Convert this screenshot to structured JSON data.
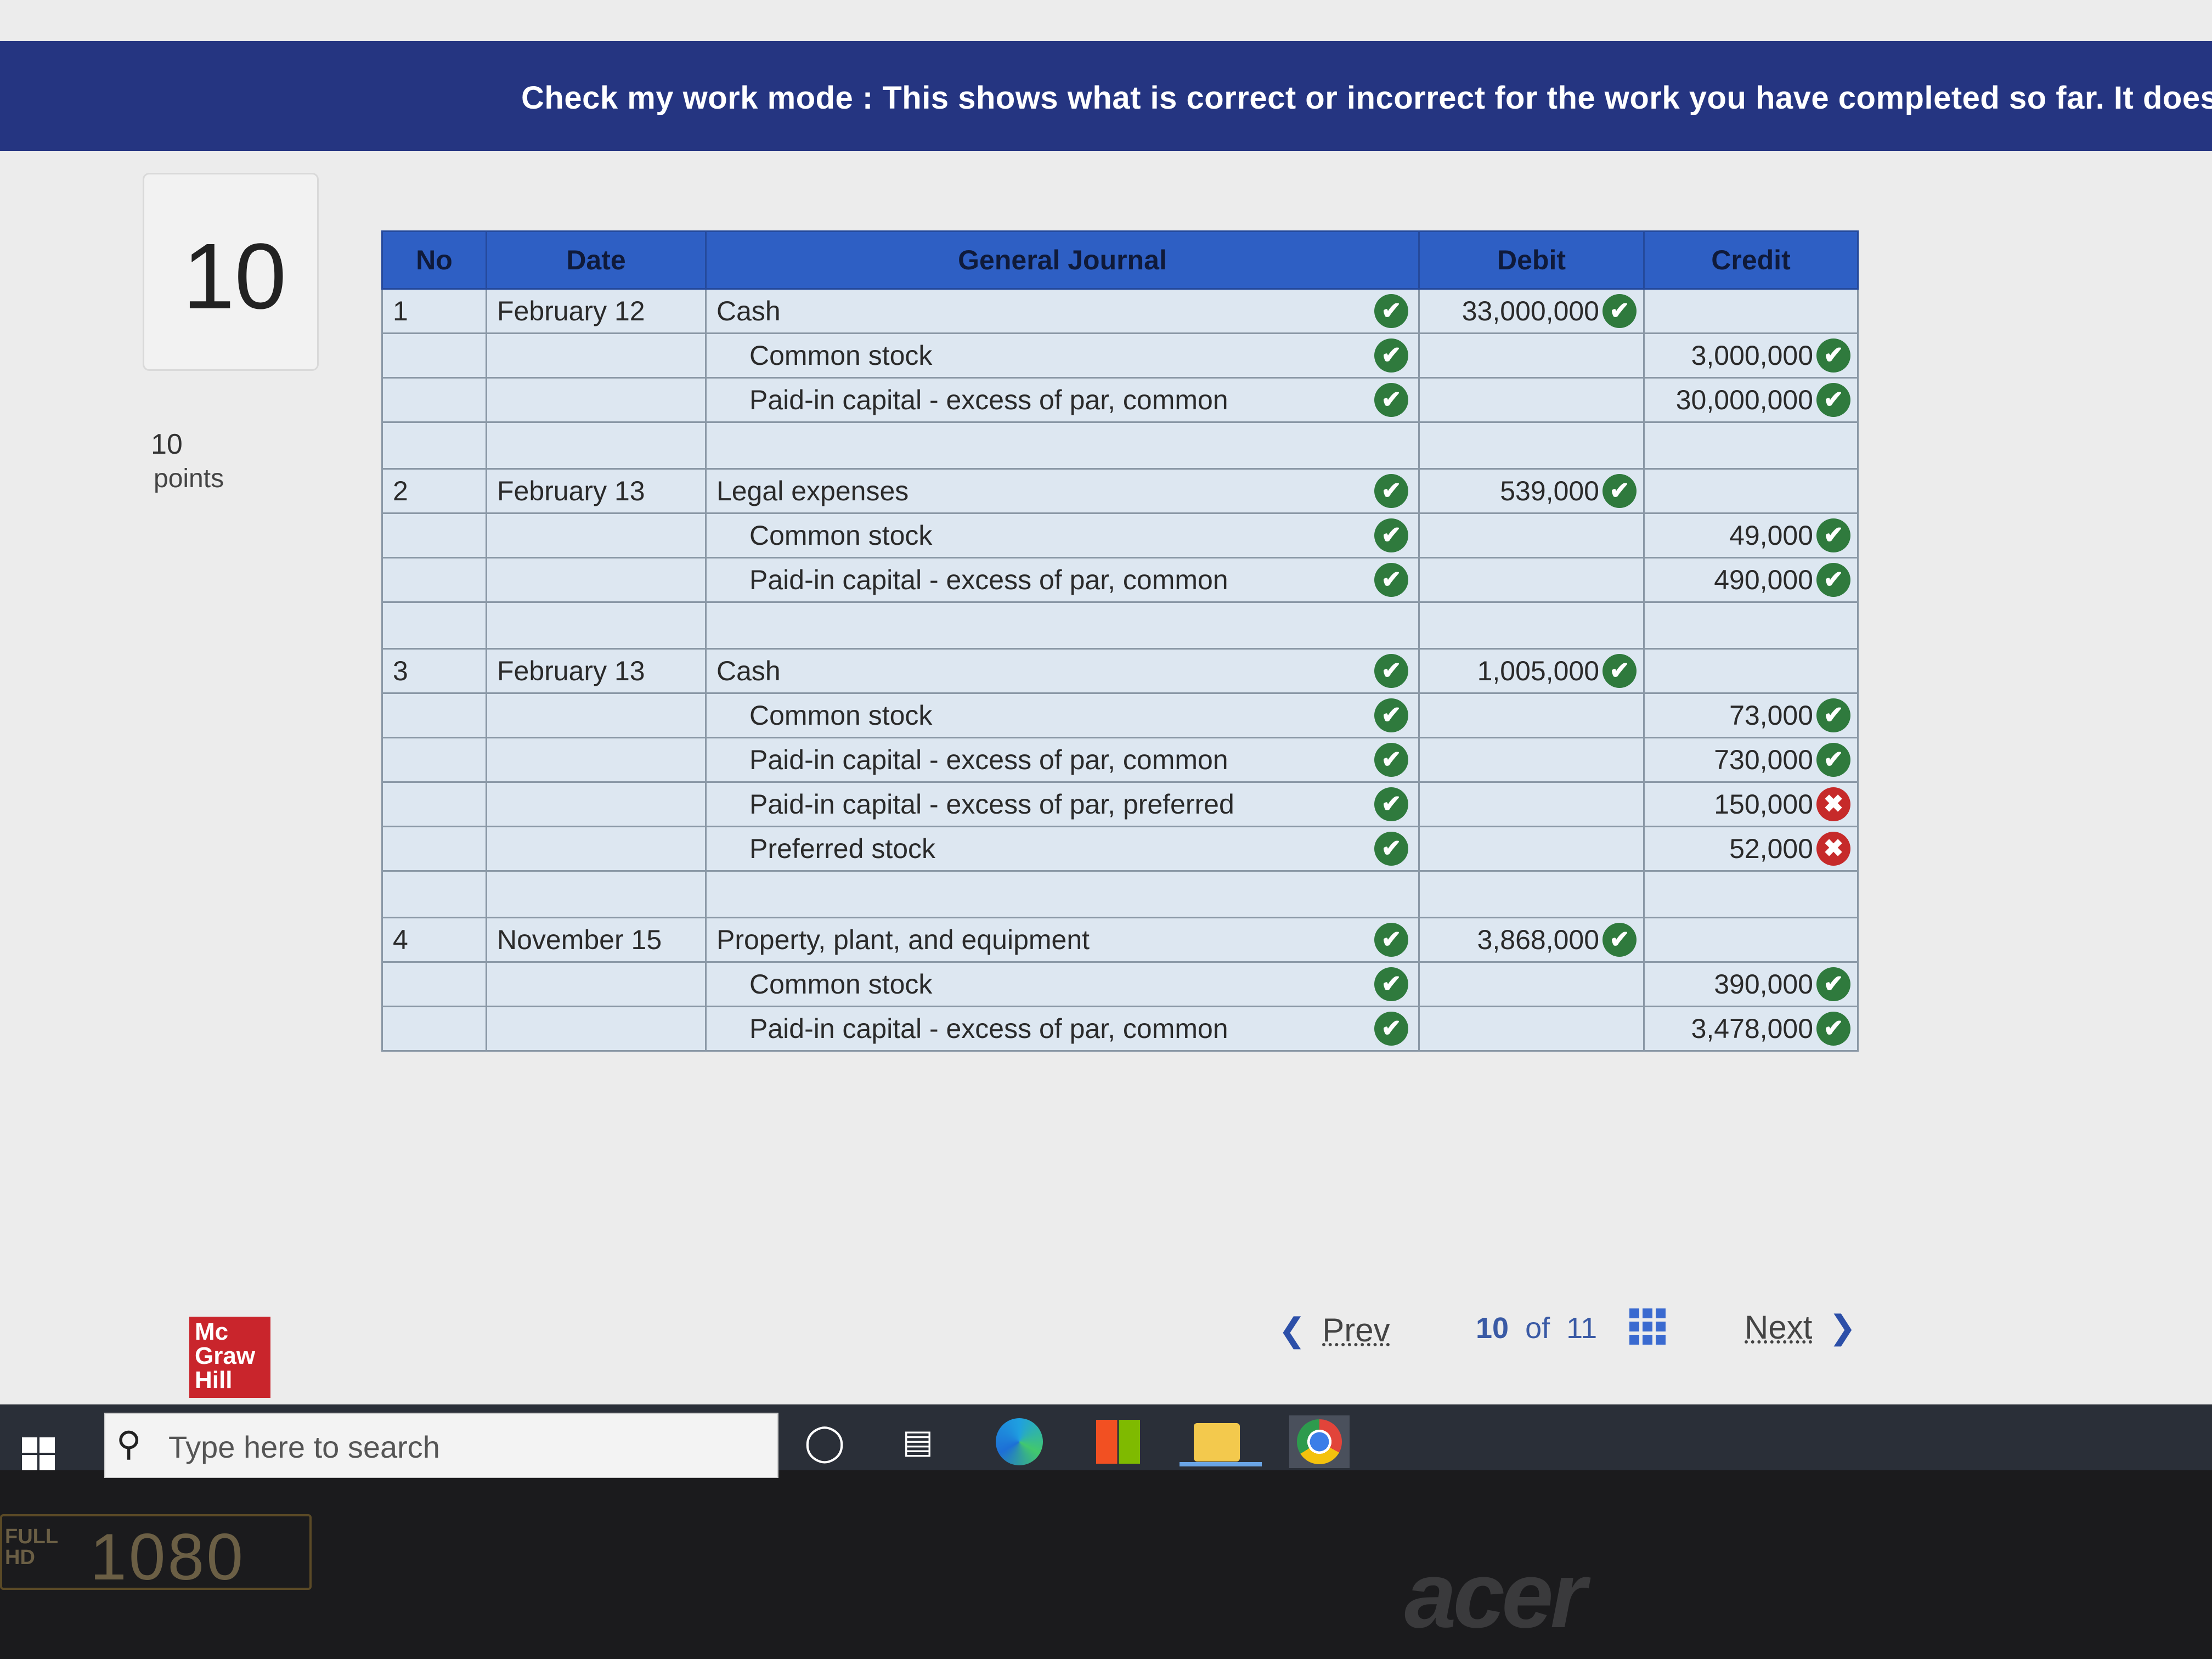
{
  "banner": {
    "text": "Check my work mode : This shows what is correct or incorrect for the work you have completed so far. It does not ir"
  },
  "question": {
    "number": "10",
    "points_value": "10",
    "points_label": "points"
  },
  "journal": {
    "headers": {
      "no": "No",
      "date": "Date",
      "account": "General Journal",
      "debit": "Debit",
      "credit": "Credit"
    },
    "rows": [
      {
        "no": "1",
        "date": "February 12",
        "account": "Cash",
        "sub": false,
        "debit": "33,000,000",
        "credit": "",
        "account_mark": "correct",
        "debit_mark": "correct",
        "credit_mark": ""
      },
      {
        "no": "",
        "date": "",
        "account": "Common stock",
        "sub": true,
        "debit": "",
        "credit": "3,000,000",
        "account_mark": "correct",
        "debit_mark": "",
        "credit_mark": "correct"
      },
      {
        "no": "",
        "date": "",
        "account": "Paid-in capital - excess of par, common",
        "sub": true,
        "debit": "",
        "credit": "30,000,000",
        "account_mark": "correct",
        "debit_mark": "",
        "credit_mark": "correct"
      },
      {
        "blank": true
      },
      {
        "no": "2",
        "date": "February 13",
        "account": "Legal expenses",
        "sub": false,
        "debit": "539,000",
        "credit": "",
        "account_mark": "correct",
        "debit_mark": "correct",
        "credit_mark": ""
      },
      {
        "no": "",
        "date": "",
        "account": "Common stock",
        "sub": true,
        "debit": "",
        "credit": "49,000",
        "account_mark": "correct",
        "debit_mark": "",
        "credit_mark": "correct"
      },
      {
        "no": "",
        "date": "",
        "account": "Paid-in capital - excess of par, common",
        "sub": true,
        "debit": "",
        "credit": "490,000",
        "account_mark": "correct",
        "debit_mark": "",
        "credit_mark": "correct"
      },
      {
        "blank": true
      },
      {
        "no": "3",
        "date": "February 13",
        "account": "Cash",
        "sub": false,
        "debit": "1,005,000",
        "credit": "",
        "account_mark": "correct",
        "debit_mark": "correct",
        "credit_mark": ""
      },
      {
        "no": "",
        "date": "",
        "account": "Common stock",
        "sub": true,
        "debit": "",
        "credit": "73,000",
        "account_mark": "correct",
        "debit_mark": "",
        "credit_mark": "correct"
      },
      {
        "no": "",
        "date": "",
        "account": "Paid-in capital - excess of par, common",
        "sub": true,
        "debit": "",
        "credit": "730,000",
        "account_mark": "correct",
        "debit_mark": "",
        "credit_mark": "correct"
      },
      {
        "no": "",
        "date": "",
        "account": "Paid-in capital - excess of par, preferred",
        "sub": true,
        "debit": "",
        "credit": "150,000",
        "account_mark": "correct",
        "debit_mark": "",
        "credit_mark": "incorrect"
      },
      {
        "no": "",
        "date": "",
        "account": "Preferred stock",
        "sub": true,
        "debit": "",
        "credit": "52,000",
        "account_mark": "correct",
        "debit_mark": "",
        "credit_mark": "incorrect"
      },
      {
        "blank": true
      },
      {
        "no": "4",
        "date": "November 15",
        "account": "Property, plant, and equipment",
        "sub": false,
        "debit": "3,868,000",
        "credit": "",
        "account_mark": "correct",
        "debit_mark": "correct",
        "credit_mark": ""
      },
      {
        "no": "",
        "date": "",
        "account": "Common stock",
        "sub": true,
        "debit": "",
        "credit": "390,000",
        "account_mark": "correct",
        "debit_mark": "",
        "credit_mark": "correct"
      },
      {
        "no": "",
        "date": "",
        "account": "Paid-in capital - excess of par, common",
        "sub": true,
        "debit": "",
        "credit": "3,478,000",
        "account_mark": "correct",
        "debit_mark": "",
        "credit_mark": "correct"
      }
    ]
  },
  "brand": {
    "logo_lines": [
      "Mc",
      "Graw",
      "Hill"
    ],
    "logo_color": "#c9252c"
  },
  "navigation": {
    "prev_label": "Prev",
    "current_page": "10",
    "of_label": "of",
    "total_pages": "11",
    "next_label": "Next",
    "prev_icon": "chevron-left-icon",
    "next_icon": "chevron-right-icon",
    "grid_icon": "grid-icon"
  },
  "taskbar": {
    "search_placeholder": "Type here to search",
    "apps": [
      "windows-start-icon",
      "cortana-icon",
      "task-view-icon",
      "edge-icon",
      "store-icon",
      "file-explorer-icon",
      "chrome-icon"
    ]
  },
  "bezel": {
    "sticker_hd_line1": "FULL",
    "sticker_hd_line2": "HD",
    "sticker_resolution": "1080",
    "brand": "acer"
  },
  "colors": {
    "banner": "#253581",
    "table_header": "#2e5fc4",
    "correct": "#2f7a3d",
    "incorrect": "#c62a2a"
  }
}
